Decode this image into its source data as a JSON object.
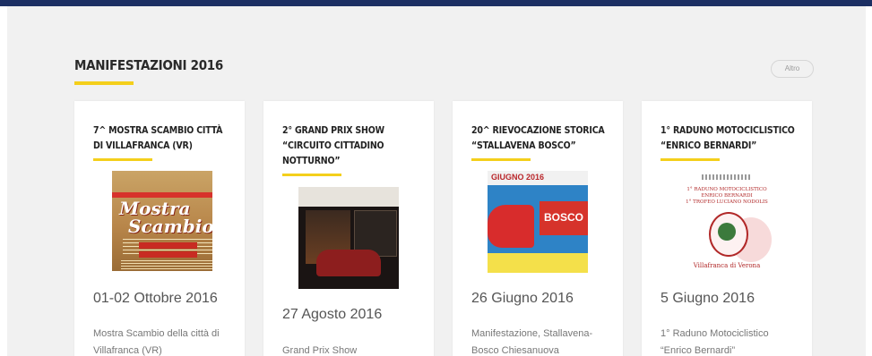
{
  "section": {
    "title": "Manifestazioni 2016",
    "more_label": "Altro"
  },
  "cards": [
    {
      "title": "7^ Mostra Scambio Città di Villafranca (VR)",
      "date": "01-02 Ottobre 2016",
      "description": "Mostra Scambio della città di Villafranca (VR)",
      "poster": {
        "line1": "Mostra",
        "line2": "Scambio"
      }
    },
    {
      "title": "2° Grand Prix Show “Circuito Cittadino Notturno”",
      "date": "27 Agosto 2016",
      "description": "Grand Prix Show"
    },
    {
      "title": "20^ Rievocazione Storica “Stallavena Bosco”",
      "date": "26 Giugno 2016",
      "description": "Manifestazione, Stallavena-Bosco Chiesanuova",
      "poster": {
        "month": "GIUGNO 2016",
        "word": "BOSCO"
      }
    },
    {
      "title": "1° Raduno Motociclistico “Enrico Bernardi”",
      "date": "5 Giugno 2016",
      "description": "1° Raduno Motociclistico “Enrico Bernardi”",
      "poster": {
        "line1": "1° RADUNO MOTOCICLISTICO",
        "line2": "ENRICO BERNARDI",
        "line3": "1° TROFEO LUCIANO NODOLIS",
        "place": "Villafranca di Verona"
      }
    }
  ],
  "colors": {
    "topbar": "#1c2f63",
    "accent": "#f4cf1b",
    "background": "#f1f1f1"
  }
}
